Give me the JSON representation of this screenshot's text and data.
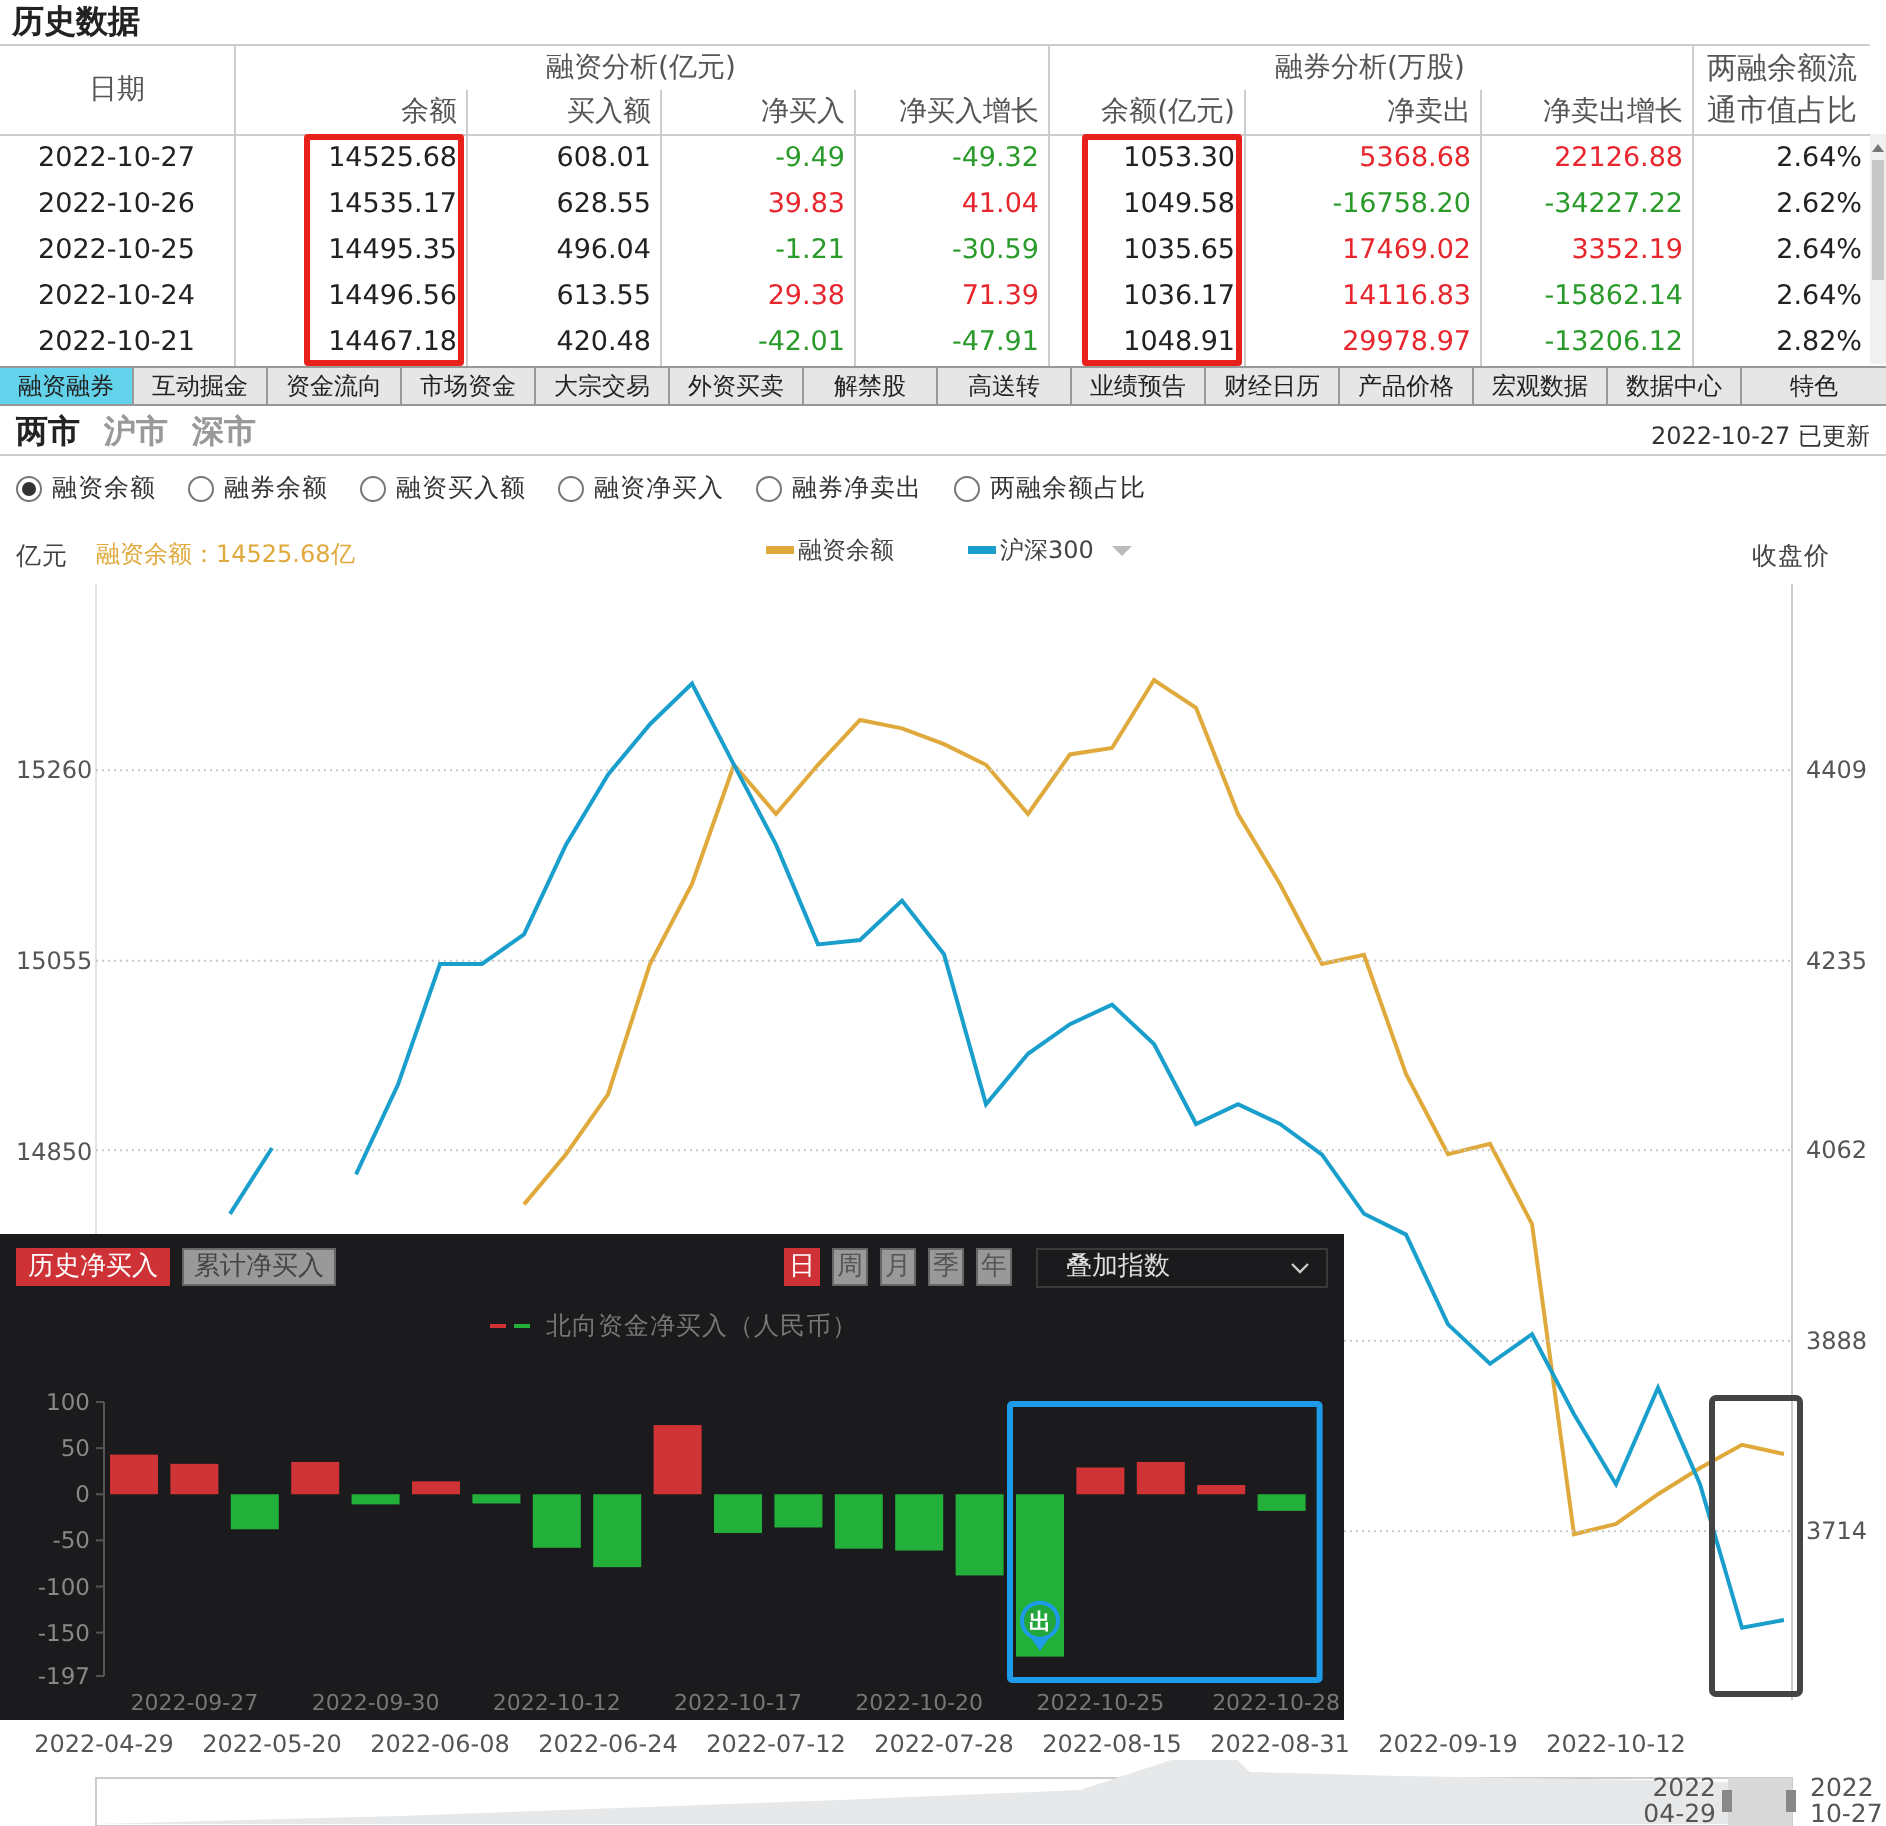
{
  "table": {
    "title": "历史数据",
    "date_header": "日期",
    "group_headers": [
      "融资分析(亿元)",
      "融券分析(万股)"
    ],
    "ratio_header": "两融余额流通市值占比",
    "columns": [
      {
        "label": "余额",
        "highlighted": true
      },
      {
        "label": "买入额",
        "highlighted": false
      },
      {
        "label": "净买入",
        "highlighted": false
      },
      {
        "label": "净买入增长",
        "highlighted": false
      },
      {
        "label": "余额(亿元)",
        "highlighted": true
      },
      {
        "label": "净卖出",
        "highlighted": false
      },
      {
        "label": "净卖出增长",
        "highlighted": false
      }
    ],
    "rows": [
      {
        "date": "2022-10-27",
        "cells": [
          {
            "text": "14525.68",
            "color": "#222222"
          },
          {
            "text": "608.01",
            "color": "#222222"
          },
          {
            "text": "-9.49",
            "color": "#2a9a2a"
          },
          {
            "text": "-49.32",
            "color": "#2a9a2a"
          },
          {
            "text": "1053.30",
            "color": "#222222"
          },
          {
            "text": "5368.68",
            "color": "#e8262d"
          },
          {
            "text": "22126.88",
            "color": "#e8262d"
          },
          {
            "text": "2.64%",
            "color": "#222222"
          }
        ]
      },
      {
        "date": "2022-10-26",
        "cells": [
          {
            "text": "14535.17",
            "color": "#222222"
          },
          {
            "text": "628.55",
            "color": "#222222"
          },
          {
            "text": "39.83",
            "color": "#e8262d"
          },
          {
            "text": "41.04",
            "color": "#e8262d"
          },
          {
            "text": "1049.58",
            "color": "#222222"
          },
          {
            "text": "-16758.20",
            "color": "#2a9a2a"
          },
          {
            "text": "-34227.22",
            "color": "#2a9a2a"
          },
          {
            "text": "2.62%",
            "color": "#222222"
          }
        ]
      },
      {
        "date": "2022-10-25",
        "cells": [
          {
            "text": "14495.35",
            "color": "#222222"
          },
          {
            "text": "496.04",
            "color": "#222222"
          },
          {
            "text": "-1.21",
            "color": "#2a9a2a"
          },
          {
            "text": "-30.59",
            "color": "#2a9a2a"
          },
          {
            "text": "1035.65",
            "color": "#222222"
          },
          {
            "text": "17469.02",
            "color": "#e8262d"
          },
          {
            "text": "3352.19",
            "color": "#e8262d"
          },
          {
            "text": "2.64%",
            "color": "#222222"
          }
        ]
      },
      {
        "date": "2022-10-24",
        "cells": [
          {
            "text": "14496.56",
            "color": "#222222"
          },
          {
            "text": "613.55",
            "color": "#222222"
          },
          {
            "text": "29.38",
            "color": "#e8262d"
          },
          {
            "text": "71.39",
            "color": "#e8262d"
          },
          {
            "text": "1036.17",
            "color": "#222222"
          },
          {
            "text": "14116.83",
            "color": "#e8262d"
          },
          {
            "text": "-15862.14",
            "color": "#2a9a2a"
          },
          {
            "text": "2.64%",
            "color": "#222222"
          }
        ]
      },
      {
        "date": "2022-10-21",
        "cells": [
          {
            "text": "14467.18",
            "color": "#222222"
          },
          {
            "text": "420.48",
            "color": "#222222"
          },
          {
            "text": "-42.01",
            "color": "#2a9a2a"
          },
          {
            "text": "-47.91",
            "color": "#2a9a2a"
          },
          {
            "text": "1048.91",
            "color": "#222222"
          },
          {
            "text": "29978.97",
            "color": "#e8262d"
          },
          {
            "text": "-13206.12",
            "color": "#2a9a2a"
          },
          {
            "text": "2.82%",
            "color": "#222222"
          }
        ]
      }
    ]
  },
  "nav_tabs": [
    {
      "label": "融资融券",
      "selected": true
    },
    {
      "label": "互动掘金",
      "selected": false
    },
    {
      "label": "资金流向",
      "selected": false
    },
    {
      "label": "市场资金",
      "selected": false
    },
    {
      "label": "大宗交易",
      "selected": false
    },
    {
      "label": "外资买卖",
      "selected": false
    },
    {
      "label": "解禁股",
      "selected": false
    },
    {
      "label": "高送转",
      "selected": false
    },
    {
      "label": "业绩预告",
      "selected": false
    },
    {
      "label": "财经日历",
      "selected": false
    },
    {
      "label": "产品价格",
      "selected": false
    },
    {
      "label": "宏观数据",
      "selected": false
    },
    {
      "label": "数据中心",
      "selected": false
    },
    {
      "label": "特色",
      "selected": false
    }
  ],
  "market_tabs": [
    {
      "label": "两市",
      "selected": true
    },
    {
      "label": "沪市",
      "selected": false
    },
    {
      "label": "深市",
      "selected": false
    }
  ],
  "updated": "2022-10-27 已更新",
  "metrics": [
    {
      "label": "融资余额",
      "selected": true
    },
    {
      "label": "融券余额",
      "selected": false
    },
    {
      "label": "融资买入额",
      "selected": false
    },
    {
      "label": "融资净买入",
      "selected": false
    },
    {
      "label": "融券净卖出",
      "selected": false
    },
    {
      "label": "两融余额占比",
      "selected": false
    }
  ],
  "main_chart": {
    "readout": "融资余额：14525.68亿",
    "balance_chart": {
      "chart_data": {
        "type": "line",
        "ylabel": "亿元",
        "categories": [
          "2022-04-29",
          null,
          null,
          null,
          "2022-05-20",
          null,
          null,
          null,
          "2022-06-08",
          null,
          null,
          null,
          "2022-06-24",
          null,
          null,
          null,
          "2022-07-12",
          null,
          null,
          null,
          "2022-07-28",
          null,
          null,
          null,
          "2022-08-15",
          null,
          null,
          null,
          "2022-08-31",
          null,
          null,
          null,
          "2022-09-19",
          null,
          null,
          null,
          "2022-10-12",
          null,
          null,
          null,
          null
        ],
        "ylim": [
          14262,
          15460
        ],
        "yticks": [
          15260,
          15055,
          14850
        ],
        "series": [
          {
            "name": "融资余额",
            "color": "#e0a93c",
            "values": [
              null,
              null,
              null,
              null,
              null,
              null,
              null,
              null,
              null,
              null,
              14794,
              14848,
              14912,
              15052,
              15138,
              15266,
              15213,
              15266,
              15314,
              15305,
              15288,
              15266,
              15213,
              15277,
              15284,
              15357,
              15327,
              15213,
              15138,
              15052,
              15062,
              14934,
              14848,
              14859,
              14773,
              14440,
              14451,
              14483,
              14511,
              14536,
              14526
            ]
          }
        ]
      }
    },
    "index_chart": {
      "highlight_recent": true,
      "chart_data": {
        "type": "line",
        "ylabel": "收盘价",
        "grid": true,
        "ylim": [
          3560,
          4579
        ],
        "yticks": [
          4409,
          4235,
          4062,
          3888,
          3714
        ],
        "series": [
          {
            "name": "沪深300",
            "color": "#1a9fcc",
            "values": [
              null,
              null,
              null,
              4004,
              4064,
              null,
              4040,
              4122,
              4232,
              4232,
              4259,
              4341,
              4405,
              4451,
              4488,
              4414,
              4341,
              4250,
              4254,
              4290,
              4241,
              4104,
              4150,
              4177,
              4195,
              4159,
              4086,
              4104,
              4086,
              4058,
              4004,
              3985,
              3903,
              3867,
              3894,
              3821,
              3757,
              3845,
              3757,
              3626,
              3633
            ]
          }
        ]
      }
    },
    "navigator": {
      "start": {
        "year": "2022",
        "date": "04-29"
      },
      "end": {
        "year": "2022",
        "date": "10-27"
      }
    }
  },
  "north_flow": {
    "views": [
      {
        "label": "历史净买入",
        "selected": true
      },
      {
        "label": "累计净买入",
        "selected": false
      }
    ],
    "periods": [
      {
        "label": "日",
        "selected": true
      },
      {
        "label": "周",
        "selected": false
      },
      {
        "label": "月",
        "selected": false
      },
      {
        "label": "季",
        "selected": false
      },
      {
        "label": "年",
        "selected": false
      }
    ],
    "overlay_select": {
      "value": "叠加指数"
    },
    "highlight_recent": true,
    "chart_data": {
      "type": "bar",
      "categories": [
        null,
        "2022-09-27",
        null,
        null,
        "2022-09-30",
        null,
        null,
        "2022-10-12",
        null,
        null,
        "2022-10-17",
        null,
        null,
        "2022-10-20",
        null,
        null,
        "2022-10-25",
        null,
        null,
        "2022-10-28"
      ],
      "ylim": [
        -197,
        100
      ],
      "yticks": [
        100,
        50,
        0,
        -50,
        -100,
        -150,
        -197
      ],
      "stacked": true,
      "series": [
        {
          "name": "北向资金净买入（人民币）",
          "color": "#d03336",
          "values": [
            43,
            33,
            null,
            35,
            null,
            14,
            null,
            null,
            null,
            75,
            null,
            null,
            null,
            null,
            null,
            null,
            29,
            35,
            10,
            null
          ]
        },
        {
          "color": "#22b03a",
          "values": [
            null,
            null,
            -38,
            null,
            -11,
            null,
            -10,
            -58,
            -79,
            null,
            -42,
            -36,
            -59,
            -61,
            -88,
            -176,
            null,
            null,
            null,
            -18
          ]
        }
      ],
      "annotations": [
        {
          "y": -176,
          "text": "出"
        }
      ]
    }
  }
}
